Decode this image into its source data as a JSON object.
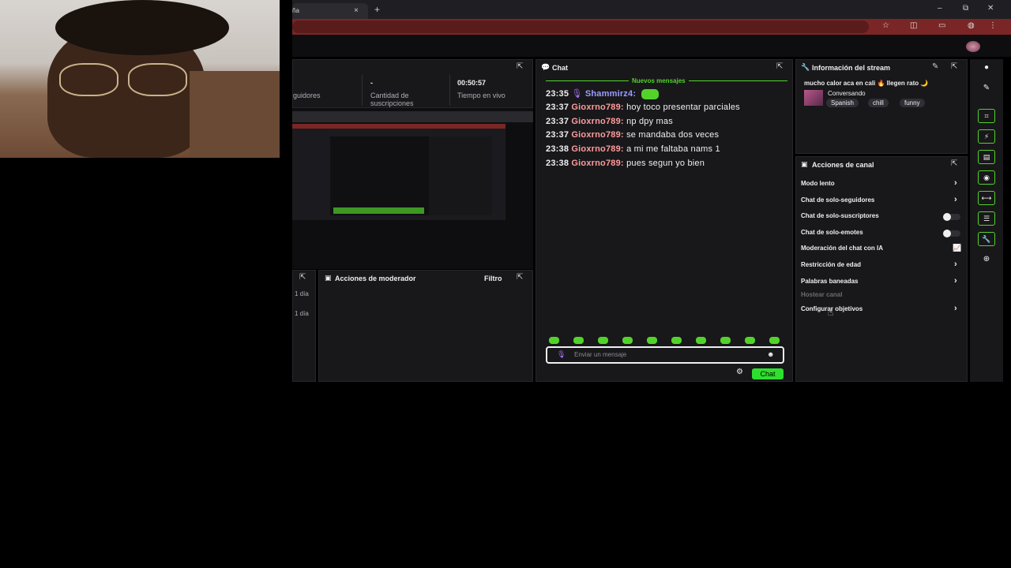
{
  "browser": {
    "tab_title": "ña",
    "close_glyph": "×",
    "new_tab_glyph": "+",
    "minimize_glyph": "–",
    "maximize_glyph": "⧉",
    "window_close_glyph": "✕"
  },
  "stats": {
    "followers_label": "guidores",
    "subs_value": "-",
    "subs_label": "Cantidad de suscripciones",
    "live_time": "00:50:57",
    "live_label": "Tiempo en vivo"
  },
  "chat": {
    "title": "Chat",
    "new_messages": "Nuevos mensajes",
    "messages": [
      {
        "time": "23:35",
        "user": "Shammirz4:",
        "text": ""
      },
      {
        "time": "23:37",
        "user": "Gioxrno789:",
        "text": "hoy toco presentar parciales"
      },
      {
        "time": "23:37",
        "user": "Gioxrno789:",
        "text": "np dpy mas"
      },
      {
        "time": "23:37",
        "user": "Gioxrno789:",
        "text": "se mandaba dos veces"
      },
      {
        "time": "23:38",
        "user": "Gioxrno789:",
        "text": "a mi me faltaba nams 1"
      },
      {
        "time": "23:38",
        "user": "Gioxrno789:",
        "text": "pues segun yo bien"
      }
    ],
    "input_placeholder": "Enviar un mensaje",
    "send_label": "Chat"
  },
  "mod_actions": {
    "title": "Acciones de moderador",
    "filter_label": "Filtro",
    "left_items": [
      "1 día",
      "1 día"
    ]
  },
  "stream_info": {
    "title": "Información del stream",
    "stream_title": "mucho calor aca en cali 🔥 llegen rato 🌙",
    "category": "Conversando",
    "tags": [
      "Spanish",
      "chill",
      "funny"
    ]
  },
  "channel_actions": {
    "title": "Acciones de canal",
    "items": [
      {
        "label": "Modo lento",
        "control": "chevron"
      },
      {
        "label": "Chat de solo-seguidores",
        "control": "chevron"
      },
      {
        "label": "Chat de solo-suscriptores",
        "control": "toggle"
      },
      {
        "label": "Chat de solo-emotes",
        "control": "toggle"
      },
      {
        "label": "Moderación del chat con IA",
        "control": "chart"
      },
      {
        "label": "Restricción de edad",
        "control": "chevron"
      },
      {
        "label": "Palabras baneadas",
        "control": "chevron"
      }
    ],
    "host_label": "Hostear canal",
    "goals_label": "Configurar objetivos"
  },
  "colors": {
    "accent_green": "#53d32a",
    "chat_button": "#2ee02e",
    "panel_bg": "#18181b",
    "browser_red": "#7a2626"
  }
}
